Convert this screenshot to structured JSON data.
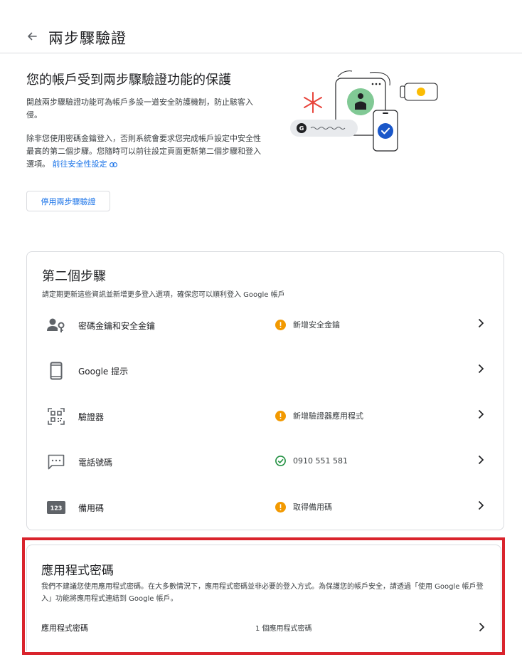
{
  "header": {
    "title": "兩步驟驗證"
  },
  "intro": {
    "title": "您的帳戶受到兩步驟驗證功能的保護",
    "paragraph1": "開啟兩步驟驗證功能可為帳戶多設一道安全防護機制，防止駭客入侵。",
    "paragraph2": "除非您使用密碼金鑰登入，否則系統會要求您完成帳戶設定中安全性最高的第二個步驟。您隨時可以前往設定頁面更新第二個步驟和登入選項。",
    "link_label": "前往安全性設定",
    "disable_button": "停用兩步驟驗證"
  },
  "second_step": {
    "title": "第二個步驟",
    "description": "請定期更新這些資訊並新增更多登入選項，確保您可以順利登入 Google 帳戶",
    "rows": [
      {
        "label": "密碼金鑰和安全金鑰",
        "status": "新增安全金鑰",
        "status_type": "warning",
        "icon": "passkey-icon"
      },
      {
        "label": "Google 提示",
        "status": "",
        "status_type": "none",
        "icon": "phone-icon"
      },
      {
        "label": "驗證器",
        "status": "新增驗證器應用程式",
        "status_type": "warning",
        "icon": "qr-code-icon"
      },
      {
        "label": "電話號碼",
        "status": "0910 551 581",
        "status_type": "ok",
        "icon": "sms-icon"
      },
      {
        "label": "備用碼",
        "status": "取得備用碼",
        "status_type": "warning",
        "icon": "backup-codes-icon"
      }
    ],
    "backup_icon_text": "123"
  },
  "app_passwords": {
    "title": "應用程式密碼",
    "description": "我們不建議您使用應用程式密碼。在大多數情況下，應用程式密碼並非必要的登入方式。為保護您的帳戶安全，請透過「使用 Google 帳戶登入」功能將應用程式連結到 Google 帳戶。",
    "row_label": "應用程式密碼",
    "row_value": "1 個應用程式密碼"
  },
  "colors": {
    "warning": "#f29900",
    "ok": "#1e8e3e",
    "link": "#1a73e8",
    "highlight": "#d9232c"
  }
}
